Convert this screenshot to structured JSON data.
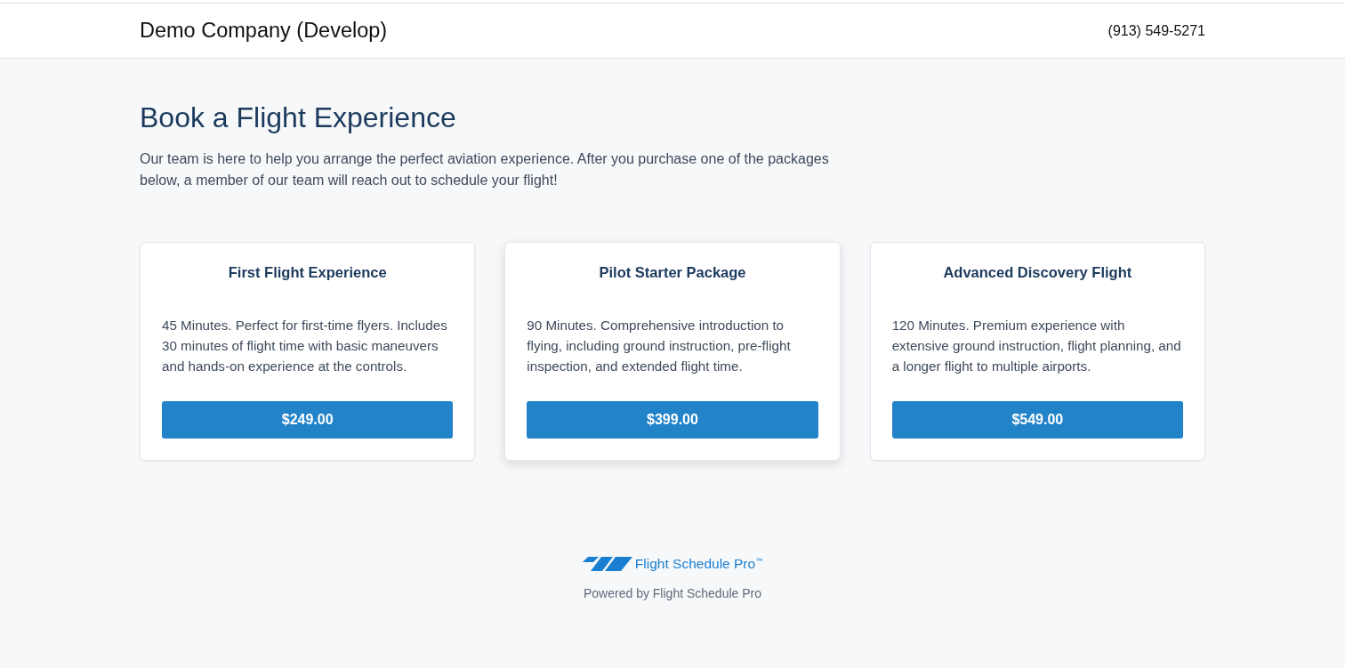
{
  "header": {
    "company": "Demo Company (Develop)",
    "phone": "(913) 549-5271"
  },
  "intro": {
    "title": "Book a Flight Experience",
    "text": "Our team is here to help you arrange the perfect aviation experience. After you purchase one of the packages below, a member of our team will reach out to schedule your flight!"
  },
  "packages": [
    {
      "name": "First Flight Experience",
      "description": "45 Minutes. Perfect for first-time flyers. Includes 30 minutes of flight time with basic maneuvers and hands-on experience at the controls.",
      "price": "$249.00",
      "hovered": false
    },
    {
      "name": "Pilot Starter Package",
      "description": "90 Minutes. Comprehensive introduction to flying, including ground instruction, pre-flight inspection, and extended flight time.",
      "price": "$399.00",
      "hovered": true
    },
    {
      "name": "Advanced Discovery Flight",
      "description": "120 Minutes. Premium experience with extensive ground instruction, flight planning, and a longer flight to multiple airports.",
      "price": "$549.00",
      "hovered": false
    }
  ],
  "footer": {
    "logo_text": "Flight Schedule Pro$^{™}$",
    "powered_by": "Powered by Flight Schedule Pro"
  }
}
